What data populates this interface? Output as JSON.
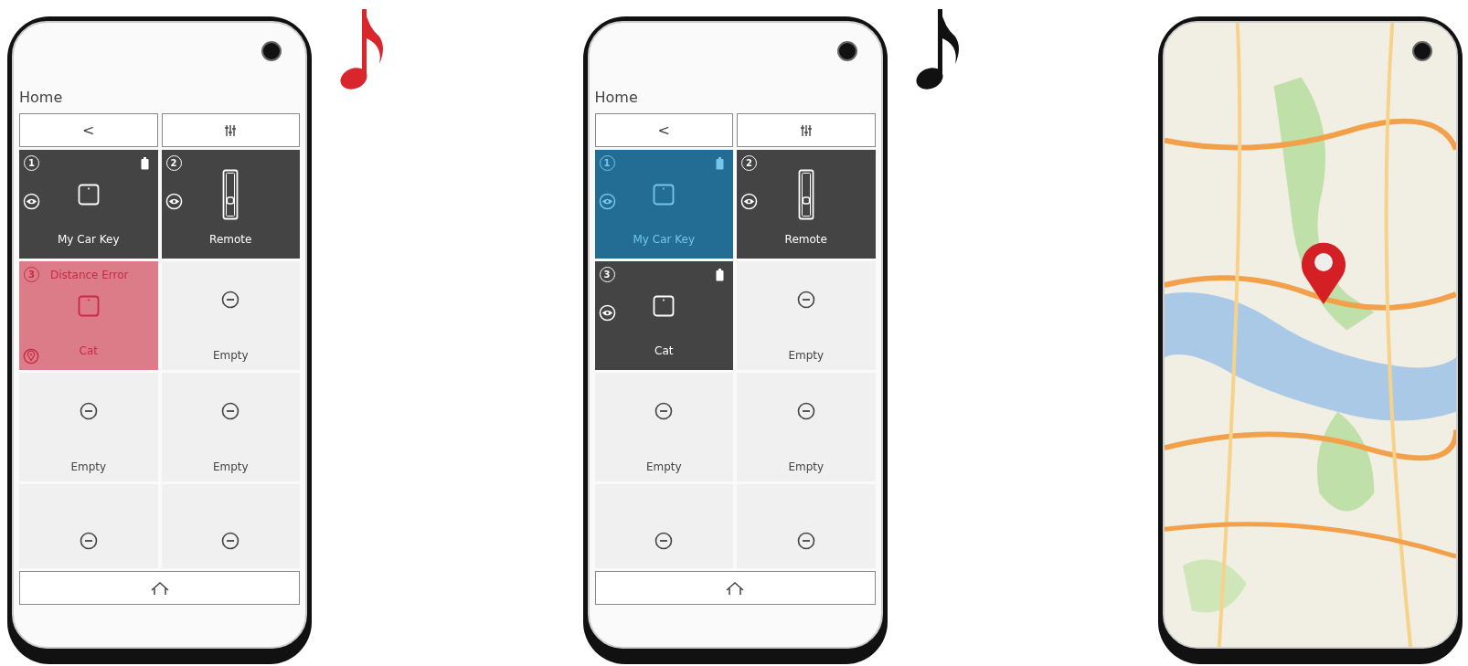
{
  "phones": [
    {
      "kind": "app",
      "note": {
        "color": "#d9262c"
      },
      "title": "Home",
      "back_label": "<",
      "tiles": [
        {
          "kind": "device",
          "number": "1",
          "device": {
            "kind": "tag"
          },
          "name": "My Car Key",
          "selected": false,
          "error": false,
          "battery": true,
          "visible": true,
          "located": false
        },
        {
          "kind": "device",
          "number": "2",
          "device": {
            "kind": "remote"
          },
          "name": "Remote",
          "selected": false,
          "error": false,
          "battery": false,
          "visible": true,
          "located": false
        },
        {
          "kind": "device",
          "number": "3",
          "device": {
            "kind": "tag"
          },
          "name": "Cat",
          "selected": false,
          "error": true,
          "status": "Distance Error",
          "battery": false,
          "visible": false,
          "located": true
        },
        {
          "kind": "empty",
          "label": "Empty"
        },
        {
          "kind": "empty",
          "label": "Empty"
        },
        {
          "kind": "empty",
          "label": "Empty"
        },
        {
          "kind": "empty"
        },
        {
          "kind": "empty"
        }
      ]
    },
    {
      "kind": "app",
      "note": {
        "color": "#111111"
      },
      "title": "Home",
      "back_label": "<",
      "tiles": [
        {
          "kind": "device",
          "number": "1",
          "device": {
            "kind": "tag"
          },
          "name": "My Car Key",
          "selected": true,
          "error": false,
          "battery": true,
          "visible": true,
          "located": false
        },
        {
          "kind": "device",
          "number": "2",
          "device": {
            "kind": "remote"
          },
          "name": "Remote",
          "selected": false,
          "error": false,
          "battery": false,
          "visible": true,
          "located": false
        },
        {
          "kind": "device",
          "number": "3",
          "device": {
            "kind": "tag"
          },
          "name": "Cat",
          "selected": false,
          "error": false,
          "battery": true,
          "visible": true,
          "located": false
        },
        {
          "kind": "empty",
          "label": "Empty"
        },
        {
          "kind": "empty",
          "label": "Empty"
        },
        {
          "kind": "empty",
          "label": "Empty"
        },
        {
          "kind": "empty"
        },
        {
          "kind": "empty"
        }
      ]
    },
    {
      "kind": "map"
    }
  ]
}
